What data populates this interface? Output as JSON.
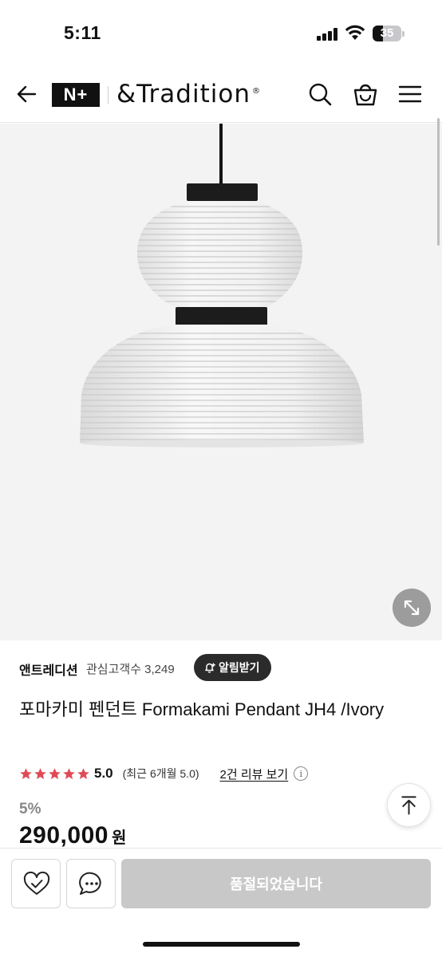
{
  "status_bar": {
    "time": "5:11",
    "battery_level": "35",
    "icons": [
      "signal-icon",
      "wifi-icon",
      "battery-icon"
    ]
  },
  "header": {
    "np_logo": "N+",
    "brand_logo": "&Tradition",
    "brand_logo_mark": "®",
    "icons": [
      "back-arrow-icon",
      "search-icon",
      "shopping-bag-icon",
      "menu-icon"
    ]
  },
  "product": {
    "brand": "앤트레디션",
    "followers_label": "관심고객수 3,249",
    "alarm_label": "알림받기",
    "title": "포마카미 펜던트 Formakami Pendant JH4 /Ivory",
    "rating_stars": 5,
    "rating_score": "5.0",
    "rating_recent": "(최근 6개월 5.0)",
    "review_link": "2건 리뷰 보기",
    "info_glyph": "i",
    "discount": "5%",
    "price": "290,000",
    "currency": "원"
  },
  "bottom_bar": {
    "soldout_label": "품절되었습니다",
    "icons": [
      "wishlist-heart-icon",
      "chat-icon"
    ]
  },
  "colors": {
    "star": "#e04a55",
    "dark": "#111111",
    "soldout_bg": "#c8c8c8",
    "image_bg": "#f3f3f3"
  }
}
